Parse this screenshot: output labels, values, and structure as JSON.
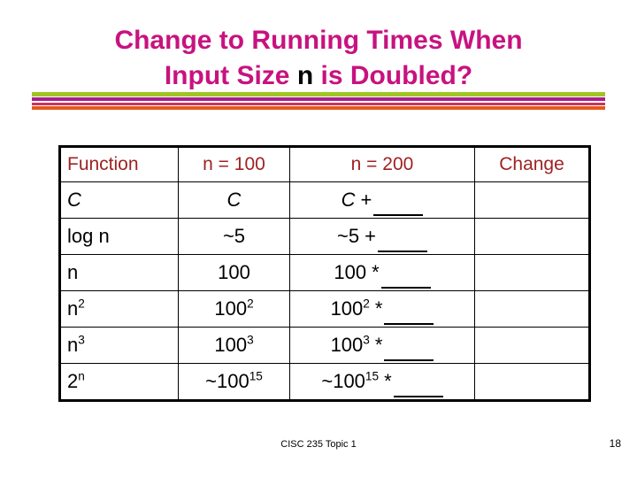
{
  "slide": {
    "title_line_1": "Change to Running Times When",
    "title_line_2_before": "Input Size ",
    "title_line_2_n": "n",
    "title_line_2_after": " is Doubled?",
    "title_color": "#c8127f",
    "accent_colors": {
      "green": "#9ec621",
      "magenta": "#a81f8f",
      "crimson": "#cf3355",
      "orange": "#e8571c"
    }
  },
  "table": {
    "header_color": "#9e2222",
    "headers": [
      "Function",
      "n = 100",
      "n = 200",
      "Change"
    ],
    "rows": [
      {
        "function": "C",
        "function_italic": true,
        "n100": "C",
        "n100_italic": true,
        "n200_value": "C",
        "n200_value_italic": true,
        "n200_operator": "+",
        "n200_blank": "",
        "change": ""
      },
      {
        "function": "log n",
        "function_italic": false,
        "n100": "~5",
        "n100_italic": false,
        "n200_value": "~5",
        "n200_value_italic": false,
        "n200_operator": "+",
        "n200_blank": "",
        "change": ""
      },
      {
        "function": "n",
        "function_italic": false,
        "n100": "100",
        "n100_italic": false,
        "n200_value": "100",
        "n200_value_italic": false,
        "n200_operator": "*",
        "n200_blank": "",
        "change": ""
      },
      {
        "function": "n",
        "function_sup": "2",
        "function_italic": false,
        "n100": "100",
        "n100_sup": "2",
        "n100_italic": false,
        "n200_value": "100",
        "n200_value_sup": "2",
        "n200_value_italic": false,
        "n200_operator": "*",
        "n200_blank": "",
        "change": ""
      },
      {
        "function": "n",
        "function_sup": "3",
        "function_italic": false,
        "n100": "100",
        "n100_sup": "3",
        "n100_italic": false,
        "n200_value": "100",
        "n200_value_sup": "3",
        "n200_value_italic": false,
        "n200_operator": "*",
        "n200_blank": "",
        "change": ""
      },
      {
        "function": "2",
        "function_sup": "n",
        "function_italic": false,
        "n100": "~100",
        "n100_sup": "15",
        "n100_italic": false,
        "n200_value": "~100",
        "n200_value_sup": "15",
        "n200_value_italic": false,
        "n200_operator": "*",
        "n200_blank": "",
        "change": ""
      }
    ]
  },
  "footer": {
    "course_note": "CISC 235 Topic 1",
    "page_number": "18"
  }
}
